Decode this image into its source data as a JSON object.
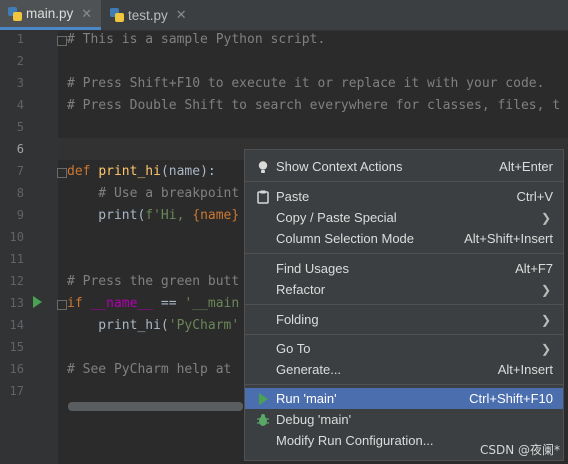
{
  "tabs": [
    {
      "label": "main.py",
      "icon": "python-file-icon",
      "close": "✕"
    },
    {
      "label": "test.py",
      "icon": "python-file-icon",
      "close": "✕"
    }
  ],
  "line_numbers": [
    "1",
    "2",
    "3",
    "4",
    "5",
    "6",
    "7",
    "8",
    "9",
    "10",
    "11",
    "12",
    "13",
    "14",
    "15",
    "16",
    "17"
  ],
  "code": {
    "l1": "# This is a sample Python script.",
    "l3": "# Press Shift+F10 to execute it or replace it with your code.",
    "l4": "# Press Double Shift to search everywhere for classes, files, t",
    "l7_def": "def ",
    "l7_name": "print_hi",
    "l7_rest": "(name):",
    "l8": "    # Use a breakpoint",
    "l9_print": "    print(",
    "l9_fstr": "f'Hi, ",
    "l9_brace": "{name}",
    "l12": "# Press the green butt",
    "l13_if": "if ",
    "l13_dn": "__name__",
    "l13_eq": " == ",
    "l13_str": "'__main",
    "l14_call": "    print_hi(",
    "l14_str": "'PyCharm'",
    "l16": "# See PyCharm help at "
  },
  "menu": {
    "show_context_actions": {
      "label": "Show Context Actions",
      "shortcut": "Alt+Enter"
    },
    "paste": {
      "label": "Paste",
      "shortcut": "Ctrl+V"
    },
    "copy_paste_special": {
      "label": "Copy / Paste Special",
      "arrow": "❯"
    },
    "column_selection_mode": {
      "label": "Column Selection Mode",
      "shortcut": "Alt+Shift+Insert"
    },
    "find_usages": {
      "label": "Find Usages",
      "shortcut": "Alt+F7"
    },
    "refactor": {
      "label": "Refactor",
      "arrow": "❯"
    },
    "folding": {
      "label": "Folding",
      "arrow": "❯"
    },
    "go_to": {
      "label": "Go To",
      "arrow": "❯"
    },
    "generate": {
      "label": "Generate...",
      "shortcut": "Alt+Insert"
    },
    "run_main": {
      "label": "Run 'main'",
      "shortcut": "Ctrl+Shift+F10"
    },
    "debug_main": {
      "label": "Debug 'main'"
    },
    "modify_run_config": {
      "label": "Modify Run Configuration..."
    }
  },
  "watermark": "CSDN @夜阑*",
  "colors": {
    "accent": "#4b6eaf",
    "run_green": "#4aa152",
    "debug_green": "#59a869",
    "comment": "#808080",
    "keyword": "#cc7832"
  }
}
